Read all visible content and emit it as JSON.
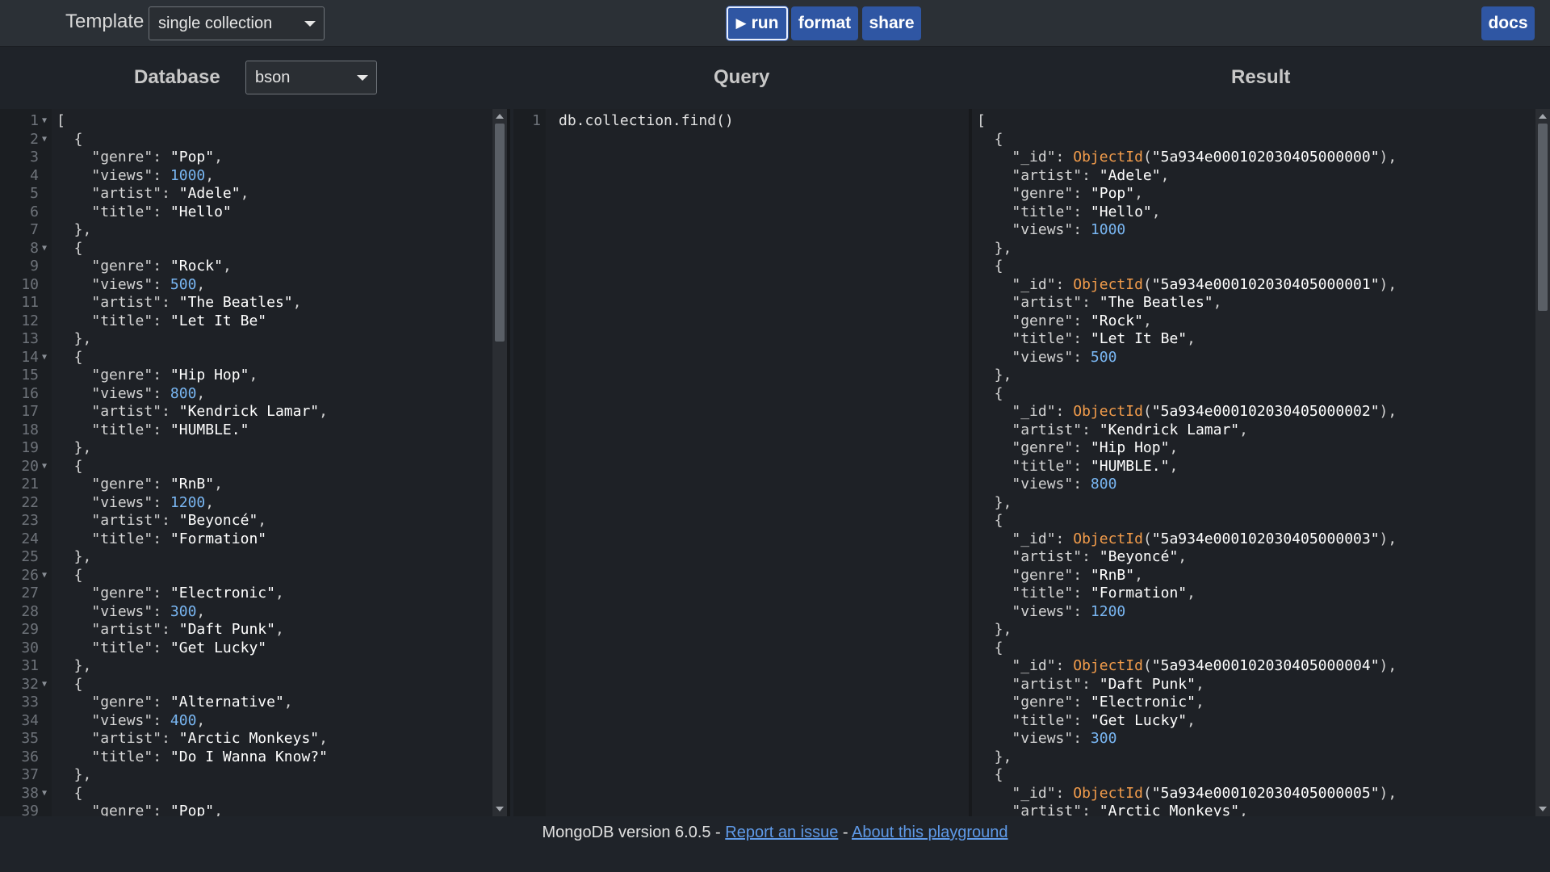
{
  "topbar": {
    "template_label": "Template",
    "template_value": "single collection",
    "run_label": "run",
    "format_label": "format",
    "share_label": "share",
    "docs_label": "docs"
  },
  "panels": {
    "database_title": "Database",
    "database_mode": "bson",
    "query_title": "Query",
    "result_title": "Result"
  },
  "database_lines": [
    "[",
    "  {",
    "    \"genre\": \"Pop\",",
    "    \"views\": 1000,",
    "    \"artist\": \"Adele\",",
    "    \"title\": \"Hello\"",
    "  },",
    "  {",
    "    \"genre\": \"Rock\",",
    "    \"views\": 500,",
    "    \"artist\": \"The Beatles\",",
    "    \"title\": \"Let It Be\"",
    "  },",
    "  {",
    "    \"genre\": \"Hip Hop\",",
    "    \"views\": 800,",
    "    \"artist\": \"Kendrick Lamar\",",
    "    \"title\": \"HUMBLE.\"",
    "  },",
    "  {",
    "    \"genre\": \"RnB\",",
    "    \"views\": 1200,",
    "    \"artist\": \"Beyoncé\",",
    "    \"title\": \"Formation\"",
    "  },",
    "  {",
    "    \"genre\": \"Electronic\",",
    "    \"views\": 300,",
    "    \"artist\": \"Daft Punk\",",
    "    \"title\": \"Get Lucky\"",
    "  },",
    "  {",
    "    \"genre\": \"Alternative\",",
    "    \"views\": 400,",
    "    \"artist\": \"Arctic Monkeys\",",
    "    \"title\": \"Do I Wanna Know?\"",
    "  },",
    "  {",
    "    \"genre\": \"Pop\","
  ],
  "database_fold_lines": [
    1,
    2,
    8,
    14,
    20,
    26,
    32,
    38
  ],
  "query_lines": [
    "db.collection.find()"
  ],
  "result_lines": [
    "[",
    "  {",
    "    \"_id\": ObjectId(\"5a934e000102030405000000\"),",
    "    \"artist\": \"Adele\",",
    "    \"genre\": \"Pop\",",
    "    \"title\": \"Hello\",",
    "    \"views\": 1000",
    "  },",
    "  {",
    "    \"_id\": ObjectId(\"5a934e000102030405000001\"),",
    "    \"artist\": \"The Beatles\",",
    "    \"genre\": \"Rock\",",
    "    \"title\": \"Let It Be\",",
    "    \"views\": 500",
    "  },",
    "  {",
    "    \"_id\": ObjectId(\"5a934e000102030405000002\"),",
    "    \"artist\": \"Kendrick Lamar\",",
    "    \"genre\": \"Hip Hop\",",
    "    \"title\": \"HUMBLE.\",",
    "    \"views\": 800",
    "  },",
    "  {",
    "    \"_id\": ObjectId(\"5a934e000102030405000003\"),",
    "    \"artist\": \"Beyoncé\",",
    "    \"genre\": \"RnB\",",
    "    \"title\": \"Formation\",",
    "    \"views\": 1200",
    "  },",
    "  {",
    "    \"_id\": ObjectId(\"5a934e000102030405000004\"),",
    "    \"artist\": \"Daft Punk\",",
    "    \"genre\": \"Electronic\",",
    "    \"title\": \"Get Lucky\",",
    "    \"views\": 300",
    "  },",
    "  {",
    "    \"_id\": ObjectId(\"5a934e000102030405000005\"),",
    "    \"artist\": \"Arctic Monkeys\","
  ],
  "footer": {
    "version_text": "MongoDB version 6.0.5 - ",
    "separator": " - ",
    "report_link": "Report an issue",
    "about_link": "About this playground"
  },
  "colors": {
    "accent_button": "#2f56a3",
    "string": "#ffffff",
    "number": "#79b6f2",
    "objectid": "#f29c4b",
    "link": "#5f9ae8"
  }
}
